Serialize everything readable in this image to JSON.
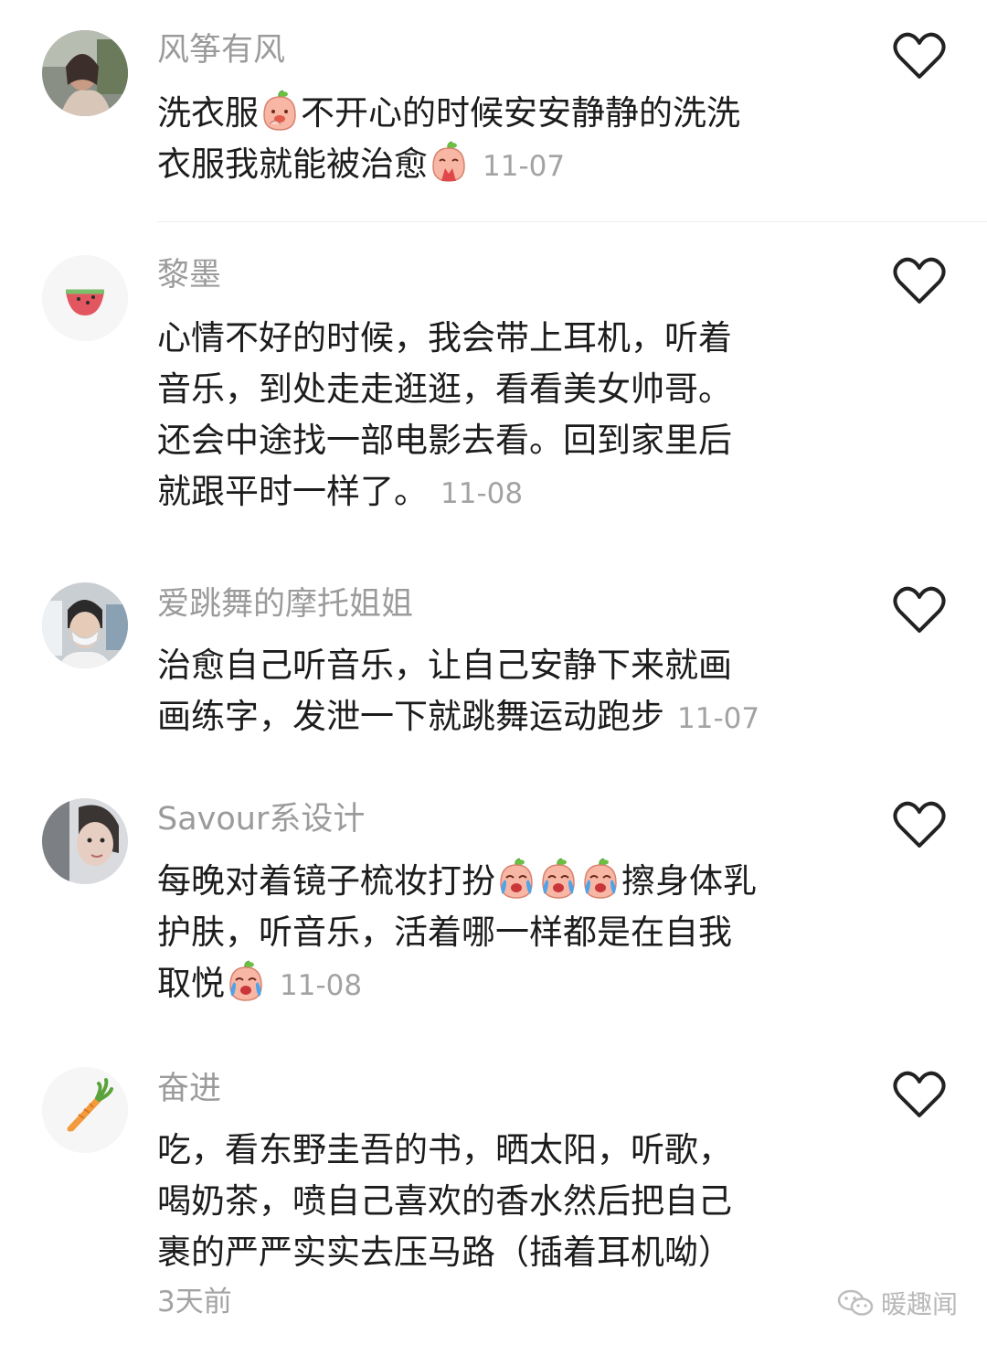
{
  "comments": [
    {
      "username": "风筝有风",
      "lines": [
        [
          {
            "t": "洗衣服"
          },
          {
            "e": "peach-shy-emoji"
          },
          {
            "t": "不开心的时候安安静静的洗洗"
          }
        ],
        [
          {
            "t": "衣服我就能被治愈"
          },
          {
            "e": "peach-pray-emoji"
          }
        ]
      ],
      "date": "11-07",
      "avatar": "photo-avatar"
    },
    {
      "username": "黎墨",
      "lines": [
        [
          {
            "t": "心情不好的时候，我会带上耳机，听着"
          }
        ],
        [
          {
            "t": "音乐，到处走走逛逛，看看美女帅哥。"
          }
        ],
        [
          {
            "t": "还会中途找一部电影去看。回到家里后"
          }
        ],
        [
          {
            "t": "就跟平时一样了。"
          }
        ]
      ],
      "date": "11-08",
      "avatar": "watermelon-icon"
    },
    {
      "username": "爱跳舞的摩托姐姐",
      "lines": [
        [
          {
            "t": "治愈自己听音乐，让自己安静下来就画"
          }
        ],
        [
          {
            "t": "画练字，发泄一下就跳舞运动跑步"
          }
        ]
      ],
      "date": "11-07",
      "avatar": "masked-person-avatar"
    },
    {
      "username": "Savour系设计",
      "lines": [
        [
          {
            "t": "每晚对着镜子梳妆打扮"
          },
          {
            "e": "peach-cry-emoji"
          },
          {
            "e": "peach-cry-emoji"
          },
          {
            "e": "peach-cry-emoji"
          },
          {
            "t": "擦身体乳"
          }
        ],
        [
          {
            "t": "护肤，听音乐，活着哪一样都是在自我"
          }
        ],
        [
          {
            "t": "取悦"
          },
          {
            "e": "peach-cry-emoji"
          }
        ]
      ],
      "date": "11-08",
      "avatar": "portrait-avatar"
    },
    {
      "username": "奋进",
      "lines": [
        [
          {
            "t": "吃，看东野圭吾的书，晒太阳，听歌，"
          }
        ],
        [
          {
            "t": "喝奶茶，喷自己喜欢的香水然后把自己"
          }
        ],
        [
          {
            "t": "裹的严严实实去压马路（插着耳机呦）"
          }
        ]
      ],
      "date": "3天前",
      "date_on_own_line": true,
      "avatar": "carrot-icon"
    }
  ],
  "watermark": "暖趣闻",
  "colors": {
    "username": "#9b9b9b",
    "text": "#1c1c1c",
    "date": "#a3a3a3",
    "divider": "#ececec",
    "heart_outline": "#222222"
  }
}
